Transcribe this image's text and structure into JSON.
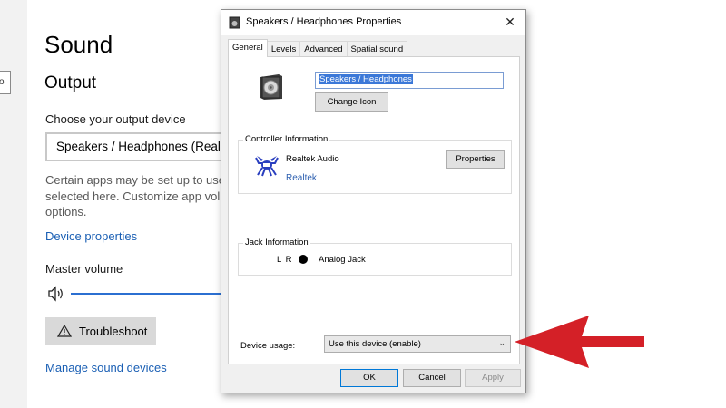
{
  "settings": {
    "title": "Sound",
    "output_heading": "Output",
    "choose_label": "Choose your output device",
    "selected_device": "Speakers / Headphones (Realtek",
    "description_lines": [
      "Certain apps may be set up to use",
      "selected here. Customize app volu",
      "options."
    ],
    "device_properties_link": "Device properties",
    "master_volume_label": "Master volume",
    "troubleshoot_label": "Troubleshoot",
    "manage_link": "Manage sound devices",
    "edge_glyph": "o"
  },
  "dialog": {
    "title": "Speakers / Headphones Properties",
    "close_glyph": "✕",
    "tabs": [
      {
        "label": "General",
        "active": true
      },
      {
        "label": "Levels",
        "active": false
      },
      {
        "label": "Advanced",
        "active": false
      },
      {
        "label": "Spatial sound",
        "active": false
      }
    ],
    "device_name_value": "Speakers / Headphones",
    "change_icon_label": "Change Icon",
    "controller": {
      "legend": "Controller Information",
      "name": "Realtek Audio",
      "vendor_link": "Realtek",
      "properties_label": "Properties"
    },
    "jack": {
      "legend": "Jack Information",
      "channels": "L R",
      "type": "Analog Jack"
    },
    "usage": {
      "label": "Device usage:",
      "selected": "Use this device (enable)"
    },
    "buttons": {
      "ok": "OK",
      "cancel": "Cancel",
      "apply": "Apply"
    }
  },
  "colors": {
    "link_blue": "#1a5fb4",
    "slider_blue": "#2b6fd1",
    "arrow_red": "#d42027",
    "selection_blue": "#3b78d8"
  },
  "icons": [
    "volume-icon",
    "warning-icon",
    "speaker-icon",
    "realtek-crab-icon",
    "close-icon",
    "chevron-down-icon",
    "red-arrow-annotation"
  ]
}
